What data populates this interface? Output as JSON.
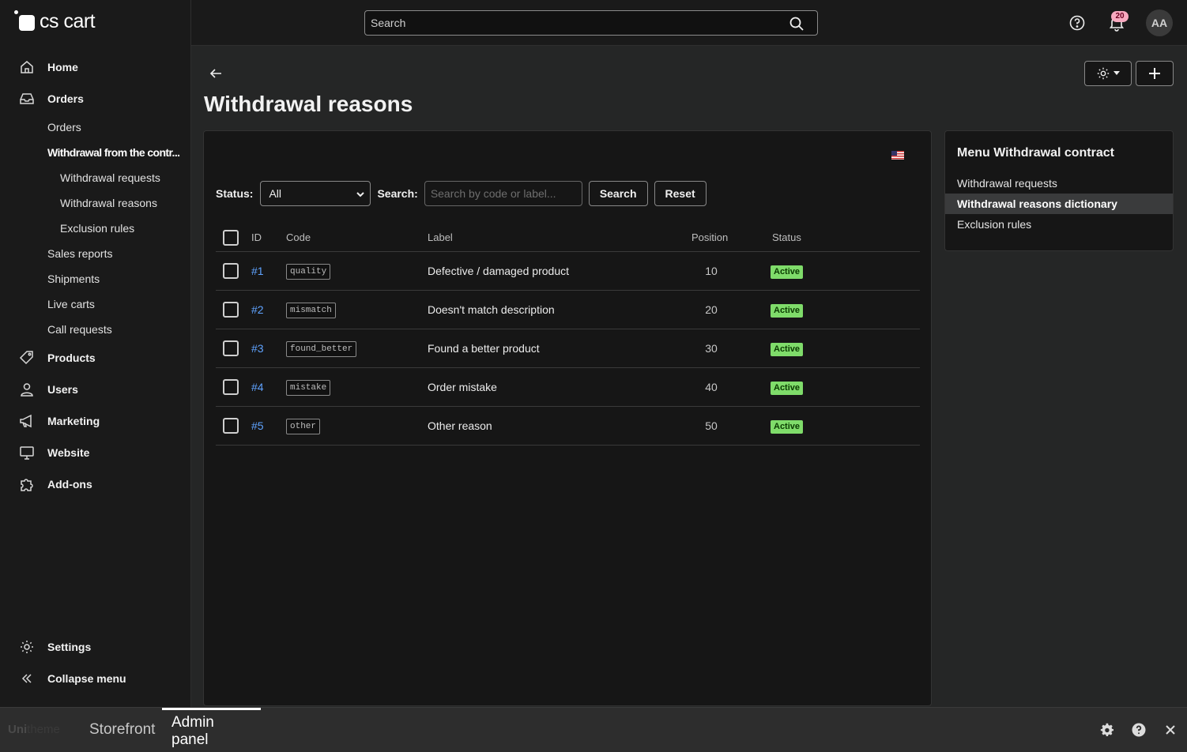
{
  "app": {
    "logo_text": "cs cart"
  },
  "sidebar": {
    "items": [
      {
        "label": "Home",
        "icon": "home-icon"
      },
      {
        "label": "Orders",
        "icon": "inbox-icon"
      },
      {
        "label": "Products",
        "icon": "tag-icon"
      },
      {
        "label": "Users",
        "icon": "user-icon"
      },
      {
        "label": "Marketing",
        "icon": "megaphone-icon"
      },
      {
        "label": "Website",
        "icon": "monitor-icon"
      },
      {
        "label": "Add-ons",
        "icon": "puzzle-icon"
      }
    ],
    "orders_sub": [
      {
        "label": "Orders"
      },
      {
        "label": "Withdrawal from the contr..."
      },
      {
        "label": "Withdrawal requests"
      },
      {
        "label": "Withdrawal reasons"
      },
      {
        "label": "Exclusion rules"
      },
      {
        "label": "Sales reports"
      },
      {
        "label": "Shipments"
      },
      {
        "label": "Live carts"
      },
      {
        "label": "Call requests"
      }
    ],
    "settings_label": "Settings",
    "collapse_label": "Collapse menu"
  },
  "topbar": {
    "search_placeholder": "Search",
    "notifications_count": "20",
    "avatar_initials": "AA"
  },
  "page": {
    "title": "Withdrawal reasons"
  },
  "filters": {
    "status_label": "Status:",
    "status_value": "All",
    "search_label": "Search:",
    "search_placeholder": "Search by code or label...",
    "search_button": "Search",
    "reset_button": "Reset"
  },
  "table": {
    "headers": [
      "ID",
      "Code",
      "Label",
      "Position",
      "Status"
    ],
    "rows": [
      {
        "id": "#1",
        "code": "quality",
        "label": "Defective / damaged product",
        "position": "10",
        "status": "Active"
      },
      {
        "id": "#2",
        "code": "mismatch",
        "label": "Doesn't match description",
        "position": "20",
        "status": "Active"
      },
      {
        "id": "#3",
        "code": "found_better",
        "label": "Found a better product",
        "position": "30",
        "status": "Active"
      },
      {
        "id": "#4",
        "code": "mistake",
        "label": "Order mistake",
        "position": "40",
        "status": "Active"
      },
      {
        "id": "#5",
        "code": "other",
        "label": "Other reason",
        "position": "50",
        "status": "Active"
      }
    ]
  },
  "right_panel": {
    "title": "Menu Withdrawal contract",
    "items": [
      {
        "label": "Withdrawal requests"
      },
      {
        "label": "Withdrawal reasons dictionary"
      },
      {
        "label": "Exclusion rules"
      }
    ]
  },
  "bottombar": {
    "brand_a": "Uni",
    "brand_b": "theme",
    "tab_storefront": "Storefront",
    "tab_admin": "Admin panel"
  },
  "colors": {
    "background": "#252626",
    "link": "#5fa3ff",
    "status_active": "#7fdc6a",
    "badge": "#f7a9bf"
  }
}
